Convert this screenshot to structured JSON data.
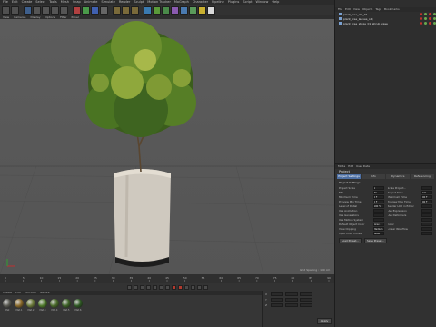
{
  "menubar": {
    "items": [
      "File",
      "Edit",
      "Create",
      "Select",
      "Tools",
      "Mesh",
      "Snap",
      "Animate",
      "Simulate",
      "Render",
      "Sculpt",
      "Motion Tracker",
      "MoGraph",
      "Character",
      "Pipeline",
      "Plugins",
      "Script",
      "Window",
      "Help"
    ]
  },
  "viewport": {
    "menu": [
      "View",
      "Cameras",
      "Display",
      "Options",
      "Filter",
      "Panel"
    ],
    "perspective_label": "Perspective",
    "grid_spacing_label": "Grid Spacing : 100 cm"
  },
  "timeline": {
    "ticks": [
      "0",
      "5",
      "10",
      "15",
      "20",
      "25",
      "30",
      "35",
      "40",
      "45",
      "50",
      "55",
      "60",
      "65",
      "70",
      "75",
      "80",
      "85",
      "90"
    ],
    "end_frame": "0 F"
  },
  "materials": {
    "menu": [
      "Create",
      "Edit",
      "Function",
      "Texture"
    ],
    "items": [
      {
        "name": "Mat",
        "color": "#5a5a52"
      },
      {
        "name": "Mat.1",
        "color": "#8a6a2a"
      },
      {
        "name": "Mat.2",
        "color": "#6b7a3a"
      },
      {
        "name": "Mat.3",
        "color": "#4e7a2b"
      },
      {
        "name": "Mat.4",
        "color": "#4a6a2a"
      },
      {
        "name": "Mat.5",
        "color": "#3e6328"
      },
      {
        "name": "Mat.6",
        "color": "#2f5a24"
      }
    ]
  },
  "coordinates": {
    "rows": [
      "X",
      "Y",
      "Z"
    ],
    "apply_label": "Apply"
  },
  "object_manager": {
    "menu": [
      "File",
      "Edit",
      "View",
      "Objects",
      "Tags",
      "Bookmarks"
    ],
    "objects": [
      {
        "name": "plant_tree_obj_01"
      },
      {
        "name": "plant_tree_leaves_obj"
      },
      {
        "name": "plant_tree_stage_01_shrub_vase"
      }
    ]
  },
  "attributes": {
    "menu": [
      "Mode",
      "Edit",
      "User Data"
    ],
    "title": "Project",
    "tabs": [
      "Project Settings",
      "Info",
      "Dynamics",
      "Referencing"
    ],
    "section": "Project Settings",
    "fields": [
      {
        "label": "Project Scale",
        "value": "1"
      },
      {
        "label": "Scale Project...",
        "value": ""
      },
      {
        "label": "FPS",
        "value": "30"
      },
      {
        "label": "Project Time",
        "value": "0 F"
      },
      {
        "label": "Minimum Time",
        "value": "0 F"
      },
      {
        "label": "Maximum Time",
        "value": "90 F"
      },
      {
        "label": "Preview Min Time",
        "value": "0 F"
      },
      {
        "label": "Preview Max Time",
        "value": "90 F"
      },
      {
        "label": "Level of Detail",
        "value": "100 %"
      },
      {
        "label": "Render LOD in Editor",
        "value": ""
      },
      {
        "label": "Use Animation",
        "value": ""
      },
      {
        "label": "Use Expression",
        "value": ""
      },
      {
        "label": "Use Generators",
        "value": ""
      },
      {
        "label": "Use Deformers",
        "value": ""
      },
      {
        "label": "Use Motion System",
        "value": ""
      },
      {
        "label": "",
        "value": ""
      },
      {
        "label": "Default Object Color",
        "value": "Gray-Blue"
      },
      {
        "label": "Color",
        "value": ""
      },
      {
        "label": "View Clipping",
        "value": "Medium"
      },
      {
        "label": "Linear Workflow",
        "value": ""
      },
      {
        "label": "Input Color Profile",
        "value": "sRGB"
      },
      {
        "label": "",
        "value": ""
      }
    ],
    "buttons": [
      "Load Preset...",
      "Save Preset..."
    ]
  }
}
